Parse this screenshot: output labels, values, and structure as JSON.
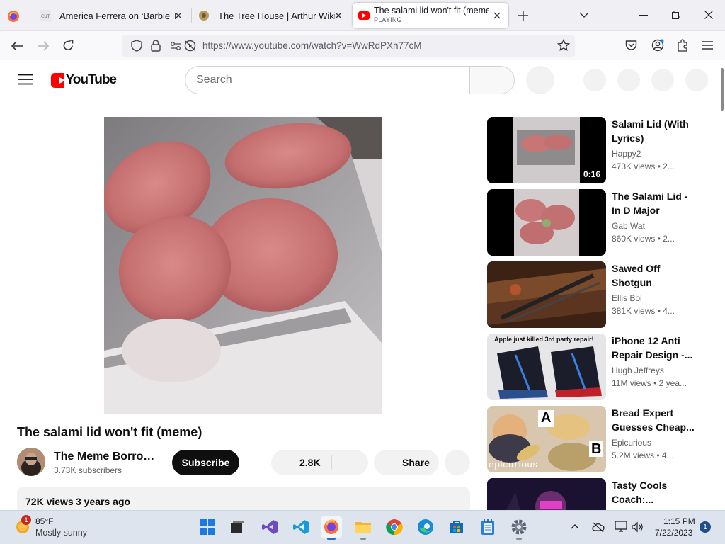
{
  "browser": {
    "tabs": [
      {
        "title": "America Ferrera on ‘Barbie’ Mo",
        "icon": "cut-site-icon"
      },
      {
        "title": "The Tree House | Arthur Wiki | F",
        "icon": "arthur-wiki-icon"
      },
      {
        "title": "The salami lid won't fit (meme)",
        "status": "PLAYING",
        "icon": "youtube-icon"
      }
    ],
    "url": "https://www.youtube.com/watch?v=WwRdPXh77cM"
  },
  "youtube": {
    "logo_text": "YouTube",
    "search_placeholder": "Search"
  },
  "video": {
    "title": "The salami lid won't fit (meme)",
    "channel": "The Meme Borrow...",
    "subscribers": "3.73K subscribers",
    "subscribe_label": "Subscribe",
    "likes": "2.8K",
    "share_label": "Share",
    "views": "72K views",
    "age": "3 years ago"
  },
  "related": [
    {
      "title": "Salami Lid (With Lyrics)",
      "channel": "Happy2",
      "meta": "473K views  • 2...",
      "duration": "0:16"
    },
    {
      "title": "The Salami Lid - In D Major",
      "channel": "Gab Wat",
      "meta": "860K views  • 2..."
    },
    {
      "title": "Sawed Off Shotgun",
      "channel": "Ellis Boi",
      "meta": "381K views  • 4..."
    },
    {
      "title": "iPhone 12 Anti Repair Design -...",
      "channel": "Hugh Jeffreys",
      "meta": "11M views  • 2 yea...",
      "thumb_text": "Apple just killed 3rd party repair!"
    },
    {
      "title": "Bread Expert Guesses Cheap...",
      "channel": "Epicurious",
      "meta": "5.2M views  • 4...",
      "thumb_text": "epicurious",
      "thumb_a": "A",
      "thumb_b": "B"
    },
    {
      "title": "Tasty Cools Coach:...",
      "channel": "",
      "meta": ""
    }
  ],
  "taskbar": {
    "weather_temp": "85°F",
    "weather_desc": "Mostly sunny",
    "weather_badge": "1",
    "time": "1:15 PM",
    "date": "7/22/2023",
    "notifications": "1"
  },
  "colors": {
    "youtube_red": "#ff0000",
    "subscribe_bg": "#0f0f0f",
    "taskbar_bg": "#dde4ee"
  }
}
